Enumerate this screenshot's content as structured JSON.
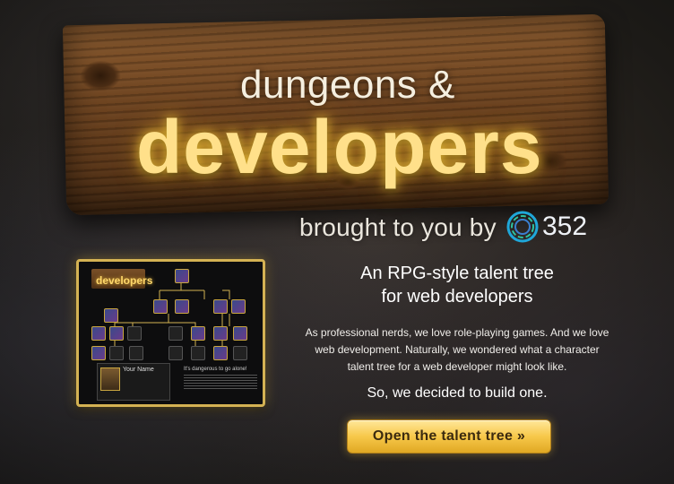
{
  "sign": {
    "title_line1": "dungeons &",
    "title_line2": "developers"
  },
  "byline": {
    "text": "brought to you by",
    "logo_icon": "352-ring-logo-icon",
    "logo_text": "352"
  },
  "preview": {
    "logo_text": "developers",
    "card_name": "Your Name",
    "alone_text": "It's dangerous to go alone!"
  },
  "content": {
    "headline_line1": "An RPG-style talent tree",
    "headline_line2": "for web developers",
    "paragraph": "As professional nerds, we love role-playing games. And we love web development. Naturally, we wondered what a character talent tree for a web developer might look like.",
    "subheadline": "So, we decided to build one."
  },
  "cta": {
    "label": "Open the talent tree »"
  },
  "colors": {
    "accent_gold": "#f7c84a",
    "glow_text": "#ffe08a",
    "wood": "#6e4420"
  }
}
